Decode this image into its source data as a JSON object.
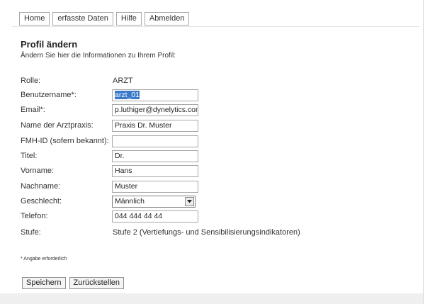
{
  "nav": {
    "items": [
      {
        "label": "Home"
      },
      {
        "label": "erfasste Daten"
      },
      {
        "label": "Hilfe"
      },
      {
        "label": "Abmelden"
      }
    ]
  },
  "page": {
    "title": "Profil ändern",
    "subtitle": "Ändern Sie hier die Informationen zu Ihrem Profil:"
  },
  "form": {
    "rolle": {
      "label": "Rolle:",
      "value": "ARZT"
    },
    "benutzername": {
      "label": "Benutzername*:",
      "value": "arzt_01"
    },
    "email": {
      "label": "Email*:",
      "value": "p.luthiger@dynelytics.com"
    },
    "praxis": {
      "label": "Name der Arztpraxis:",
      "value": "Praxis Dr. Muster"
    },
    "fmh": {
      "label": "FMH-ID (sofern bekannt):",
      "value": ""
    },
    "titel": {
      "label": "Titel:",
      "value": "Dr."
    },
    "vorname": {
      "label": "Vorname:",
      "value": "Hans"
    },
    "nachname": {
      "label": "Nachname:",
      "value": "Muster"
    },
    "geschlecht": {
      "label": "Geschlecht:",
      "value": "Männlich"
    },
    "telefon": {
      "label": "Telefon:",
      "value": "044 444 44 44"
    },
    "stufe": {
      "label": "Stufe:",
      "value": "Stufe 2 (Vertiefungs- und Sensibilisierungsindikatoren)"
    }
  },
  "required_note": "* Angabe erforderlich",
  "actions": {
    "save_label": "Speichern",
    "reset_label": "Zurückstellen"
  },
  "icons": {
    "select_arrow": "chevron-down-icon"
  },
  "colors": {
    "selection": "#3a79c9",
    "border": "#a7a7a7"
  }
}
